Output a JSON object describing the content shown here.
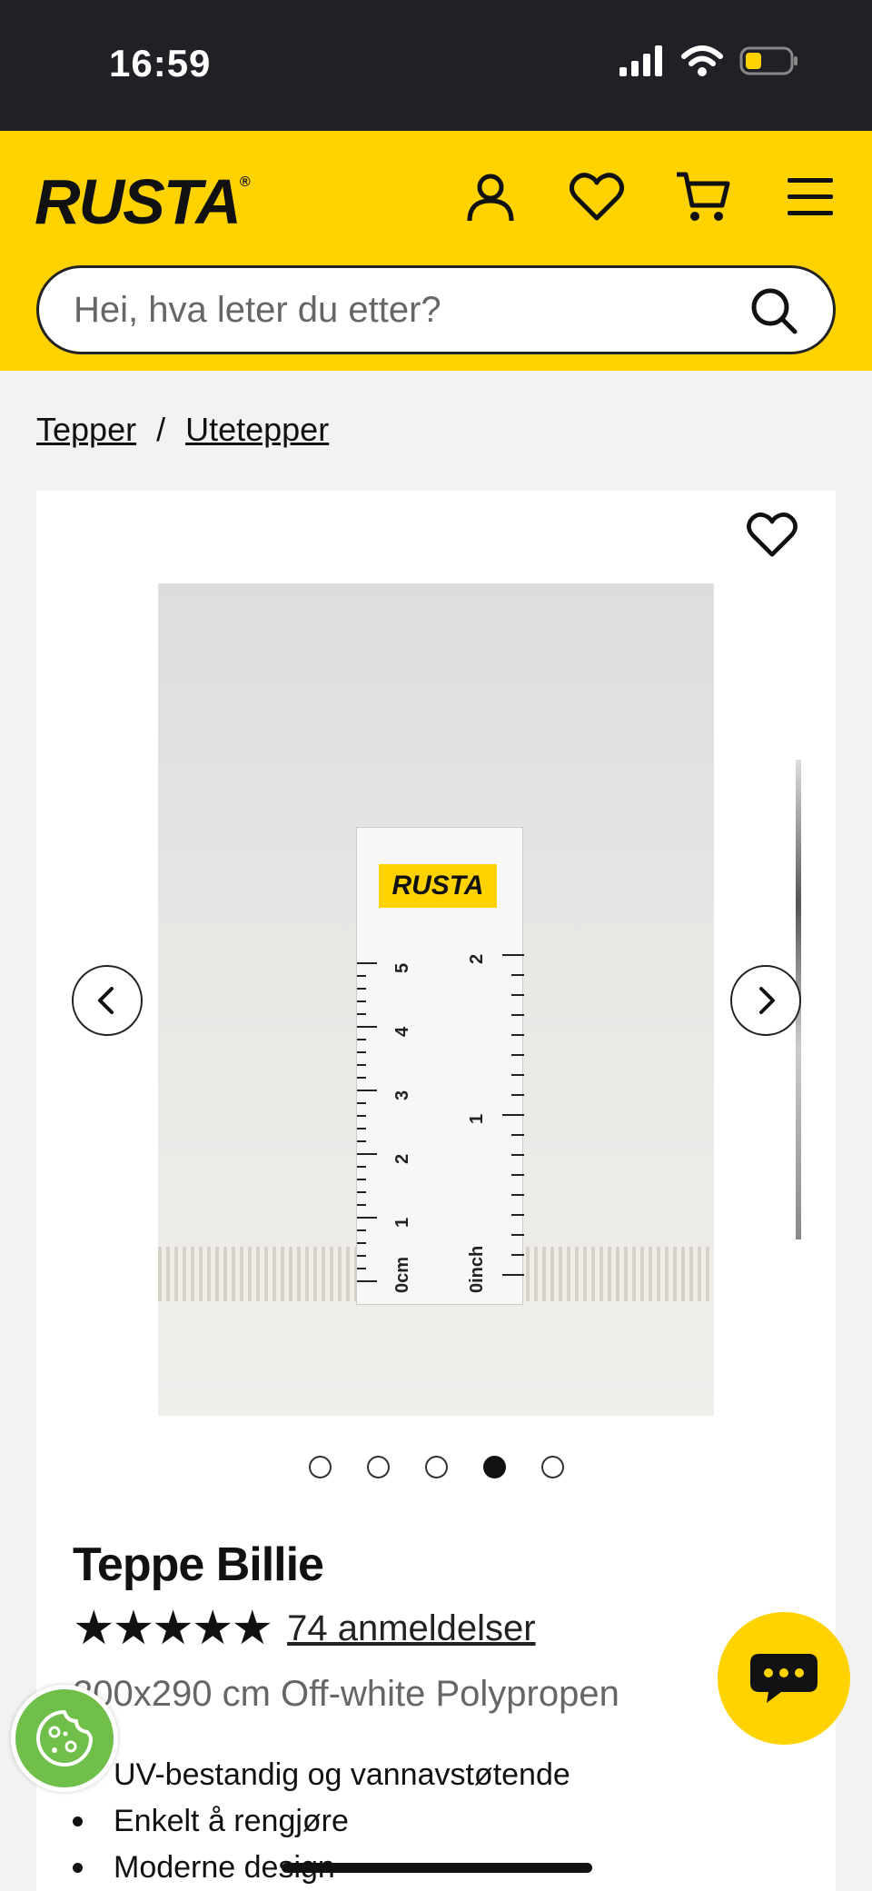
{
  "status_bar": {
    "time": "16:59"
  },
  "header": {
    "logo": "RUSTA",
    "search_placeholder": "Hei, hva leter du etter?"
  },
  "breadcrumb": {
    "items": [
      "Tepper",
      "Utetepper"
    ],
    "separator": "/"
  },
  "gallery": {
    "ruler_logo": "RUSTA",
    "ruler_cm_labels": [
      "0cm",
      "1",
      "2",
      "3",
      "4",
      "5"
    ],
    "ruler_inch_labels": [
      "0inch",
      "1",
      "2"
    ],
    "slide_count": 5,
    "active_slide": 4
  },
  "product": {
    "title": "Teppe Billie",
    "stars": "★★★★★",
    "rating_fraction": 1.0,
    "reviews_text": "74 anmeldelser",
    "subtitle": "200x290 cm Off-white Polypropen",
    "features": [
      "UV-bestandig og vannavstøtende",
      "Enkelt å rengjøre",
      "Moderne design"
    ]
  },
  "colors": {
    "brand_yellow": "#ffd200",
    "status_bar": "#202126",
    "cookie_green": "#6fbf4a"
  },
  "icons": [
    "signal-icon",
    "wifi-icon",
    "battery-icon",
    "account-icon",
    "heart-icon",
    "cart-icon",
    "menu-icon",
    "search-icon",
    "chevron-left-icon",
    "chevron-right-icon",
    "chat-icon",
    "cookie-icon"
  ]
}
